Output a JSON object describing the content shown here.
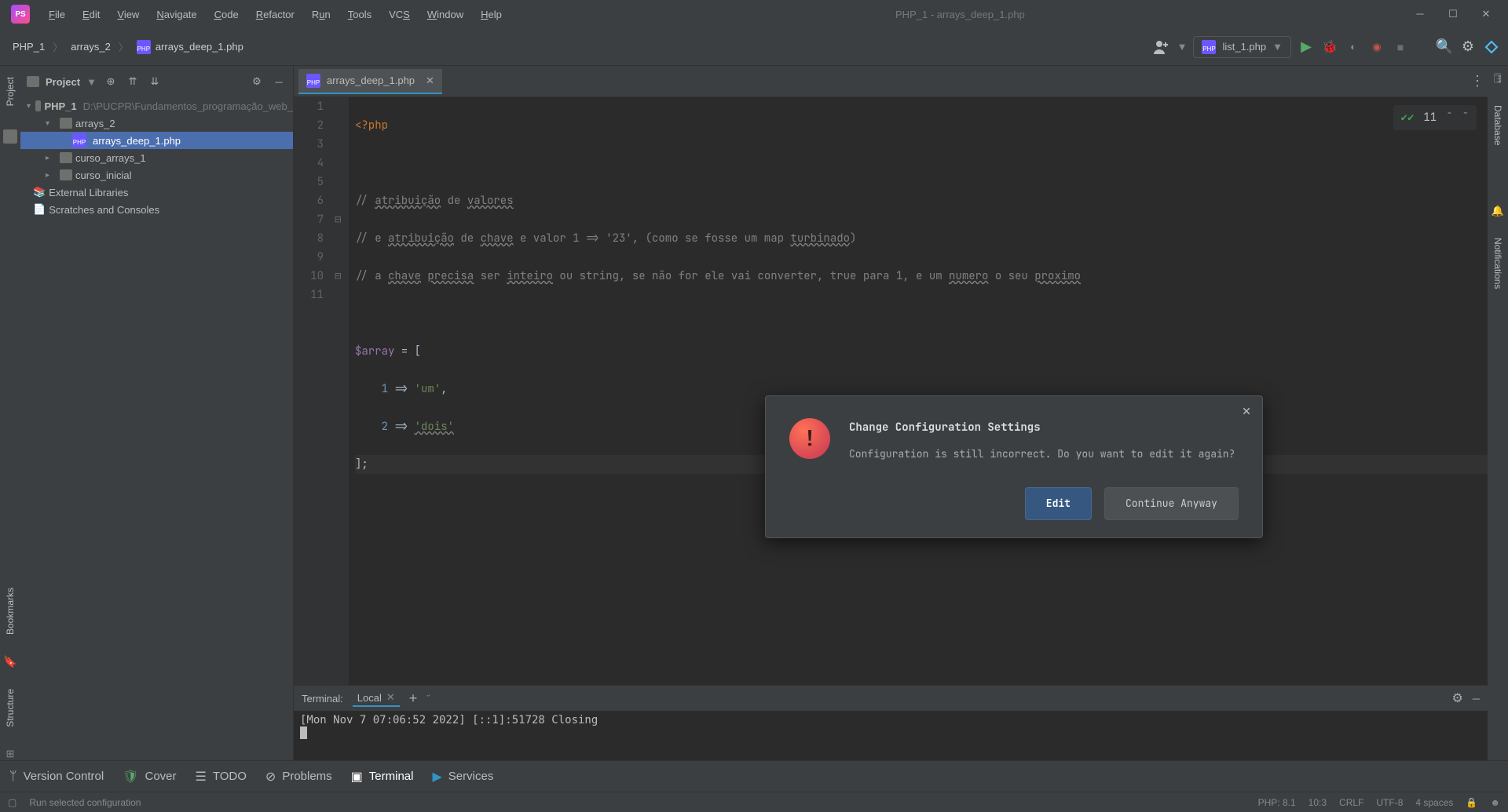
{
  "title": "PHP_1 - arrays_deep_1.php",
  "menu": [
    "File",
    "Edit",
    "View",
    "Navigate",
    "Code",
    "Refactor",
    "Run",
    "Tools",
    "VCS",
    "Window",
    "Help"
  ],
  "breadcrumbs": [
    "PHP_1",
    "arrays_2",
    "arrays_deep_1.php"
  ],
  "run_configuration": "list_1.php",
  "project_panel": {
    "title": "Project",
    "tree": {
      "root": "PHP_1",
      "root_path": "D:\\PUCPR\\Fundamentos_programação_web_",
      "arrays_2": "arrays_2",
      "arrays_deep": "arrays_deep_1.php",
      "curso_arrays_1": "curso_arrays_1",
      "curso_inicial": "curso_inicial",
      "ext_lib": "External Libraries",
      "scratches": "Scratches and Consoles"
    }
  },
  "editor": {
    "tab_label": "arrays_deep_1.php",
    "inspection_count": "11",
    "line_numbers": [
      "1",
      "2",
      "3",
      "4",
      "5",
      "6",
      "7",
      "8",
      "9",
      "10",
      "11"
    ],
    "lines": {
      "l1_kw": "<?php",
      "l3_pre": "// ",
      "l3_u1": "atribuição",
      "l3_mid": " de ",
      "l3_u2": "valores",
      "l4_pre": "// e ",
      "l4_u1": "atribuição",
      "l4_mid1": " de ",
      "l4_u2": "chave",
      "l4_mid2": " e valor 1 => '23', (como se fosse um map ",
      "l4_u3": "turbinado",
      "l4_post": ")",
      "l5_pre": "// a ",
      "l5_u1": "chave",
      "l5_sp1": " ",
      "l5_u2": "precisa",
      "l5_mid1": " ser ",
      "l5_u3": "inteiro",
      "l5_mid2": " ou string, se não for ele vai converter, true para 1, e um ",
      "l5_u4": "numero",
      "l5_mid3": " o seu ",
      "l5_u5": "proximo",
      "l7_var": "$array",
      "l7_rest": " = [",
      "l8_indent": "    ",
      "l8_num": "1",
      "l8_arrow": " => ",
      "l8_str": "'um'",
      "l8_comma": ",",
      "l9_indent": "    ",
      "l9_num": "2",
      "l9_arrow": " => ",
      "l9_str": "'dois'",
      "l10": "];"
    }
  },
  "dialog": {
    "title": "Change Configuration Settings",
    "message": "Configuration is still incorrect. Do you want to edit it again?",
    "edit": "Edit",
    "continue": "Continue Anyway"
  },
  "terminal": {
    "label": "Terminal:",
    "tab": "Local",
    "output": "[Mon Nov  7 07:06:52 2022] [::1]:51728 Closing"
  },
  "bottom_tools": {
    "version_control": "Version Control",
    "cover": "Cover",
    "todo": "TODO",
    "problems": "Problems",
    "terminal": "Terminal",
    "services": "Services"
  },
  "status": {
    "hint": "Run selected configuration",
    "php": "PHP: 8.1",
    "pos": "10:3",
    "eol": "CRLF",
    "enc": "UTF-8",
    "indent": "4 spaces"
  },
  "rails": {
    "project": "Project",
    "bookmarks": "Bookmarks",
    "structure": "Structure",
    "database": "Database",
    "notifications": "Notifications"
  }
}
